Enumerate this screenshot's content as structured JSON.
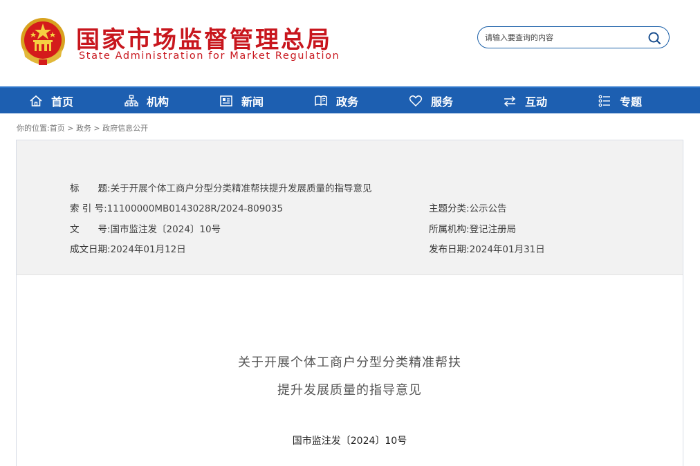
{
  "header": {
    "title_cn": "国家市场监督管理总局",
    "title_en": "State Administration for Market Regulation",
    "emblem_icon": "national-emblem-icon"
  },
  "search": {
    "placeholder": "请输入要查询的内容",
    "icon": "search-icon"
  },
  "nav": {
    "items": [
      {
        "label": "首页",
        "icon": "home-icon"
      },
      {
        "label": "机构",
        "icon": "org-chart-icon"
      },
      {
        "label": "新闻",
        "icon": "newspaper-icon"
      },
      {
        "label": "政务",
        "icon": "book-icon"
      },
      {
        "label": "服务",
        "icon": "heart-icon"
      },
      {
        "label": "互动",
        "icon": "swap-arrows-icon"
      },
      {
        "label": "专题",
        "icon": "list-icon"
      }
    ]
  },
  "breadcrumb": {
    "prefix": "你的位置:",
    "items": [
      "首页",
      "政务",
      "政府信息公开"
    ],
    "separator": " > "
  },
  "meta": {
    "title_label": "标　　题:",
    "title_value": "关于开展个体工商户分型分类精准帮扶提升发展质量的指导意见",
    "index_label": "索 引 号:",
    "index_value": "11100000MB0143028R/2024-809035",
    "category_label": "主题分类:",
    "category_value": "公示公告",
    "doc_label": "文　　号:",
    "doc_value": "国市监注发〔2024〕10号",
    "org_label": "所属机构:",
    "org_value": "登记注册局",
    "written_label": "成文日期:",
    "written_value": "2024年01月12日",
    "published_label": "发布日期:",
    "published_value": "2024年01月31日"
  },
  "document": {
    "title_line1": "关于开展个体工商户分型分类精准帮扶",
    "title_line2": "提升发展质量的指导意见",
    "number": "国市监注发〔2024〕10号"
  },
  "colors": {
    "brand_red": "#c8161d",
    "nav_blue": "#1d5fb1",
    "meta_bg": "#f2f2f2"
  }
}
